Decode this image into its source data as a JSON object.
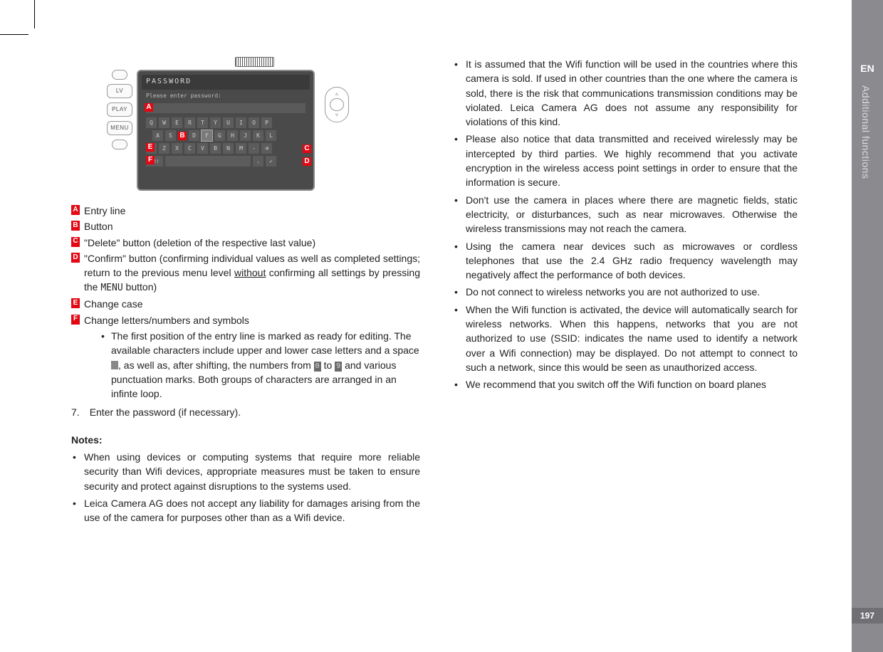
{
  "sideTab": {
    "lang": "EN",
    "section": "Additional functions",
    "page": "197"
  },
  "device": {
    "buttons": [
      "LV",
      "PLAY",
      "MENU"
    ],
    "title": "PASSWORD",
    "subtitle": "Please enter password:",
    "rows": {
      "r1": [
        "Q",
        "W",
        "E",
        "R",
        "T",
        "Y",
        "U",
        "I",
        "O",
        "P"
      ],
      "r2": [
        "A",
        "S",
        "D",
        "F",
        "G",
        "H",
        "J",
        "K",
        "L"
      ],
      "r3": [
        "Z",
        "X",
        "C",
        "V",
        "B",
        "N",
        "M",
        "-"
      ],
      "r4_left": "12!",
      "r4_right": "."
    },
    "callouts": {
      "A": "A",
      "B": "B",
      "C": "C",
      "D": "D",
      "E": "E",
      "F": "F"
    }
  },
  "legend": {
    "A": "Entry line",
    "B": "Button",
    "C": "\"Delete\" button (deletion of the respective last value)",
    "D_pre": "\"Confirm\" button (confirming individual values as well as completed settings; return to the previous menu level ",
    "D_und": "without",
    "D_post": " confirming all settings by pressing the ",
    "D_mono": "MENU",
    "D_tail": " button)",
    "E": "Change case",
    "F": "Change letters/numbers and symbols"
  },
  "subBullet": {
    "seg1": "The first position of the entry line is marked as ready for editing. The available characters include upper and lower case letters and a space ",
    "seg2": ", as well as, after shifting, the numbers from ",
    "n0": "0",
    "seg3": " to ",
    "n9": "9",
    "seg4": " and various punctuation marks. Both groups of characters are arranged in an infinte loop."
  },
  "step7": {
    "n": "7.",
    "txt": "Enter the password (if necessary)."
  },
  "notesHeading": "Notes:",
  "leftNotes": [
    "When using devices or computing systems that require more reliable security than Wifi devices, appropriate measures must be taken to ensure security and protect against disruptions to the systems used.",
    "Leica Camera AG does not accept any liability for damages arising from the use of the camera for purposes other than as a Wifi device."
  ],
  "rightNotes": [
    "It is assumed that the Wifi function will be used in the countries where this camera is sold. If used in other countries than the one where the camera is sold, there is the risk that communications transmission conditions may be violated. Leica Camera AG does not assume any responsibility for violations of this kind.",
    "Please also notice that data transmitted and received wirelessly may be intercepted by third parties. We highly recommend that you activate encryption in the wireless access point settings in order to ensure that the information is secure.",
    "Don't use the camera in places where there are magnetic fields, static electricity, or disturbances, such as near microwaves. Otherwise the wireless transmissions may not reach the camera.",
    "Using the camera near devices such as microwaves or cordless telephones that use the 2.4 GHz radio frequency wavelength may negatively affect the performance of both devices.",
    "Do not connect to wireless networks you are not authorized to use.",
    "When the Wifi function is activated, the device will automatically search for wireless networks. When this happens, networks that you are not authorized to use (SSID: indicates the name used to identify a network over a Wifi connection) may be displayed. Do not attempt to connect to such a network, since this would be seen as unauthorized access.",
    "We recommend that you switch off the Wifi function on board planes"
  ]
}
